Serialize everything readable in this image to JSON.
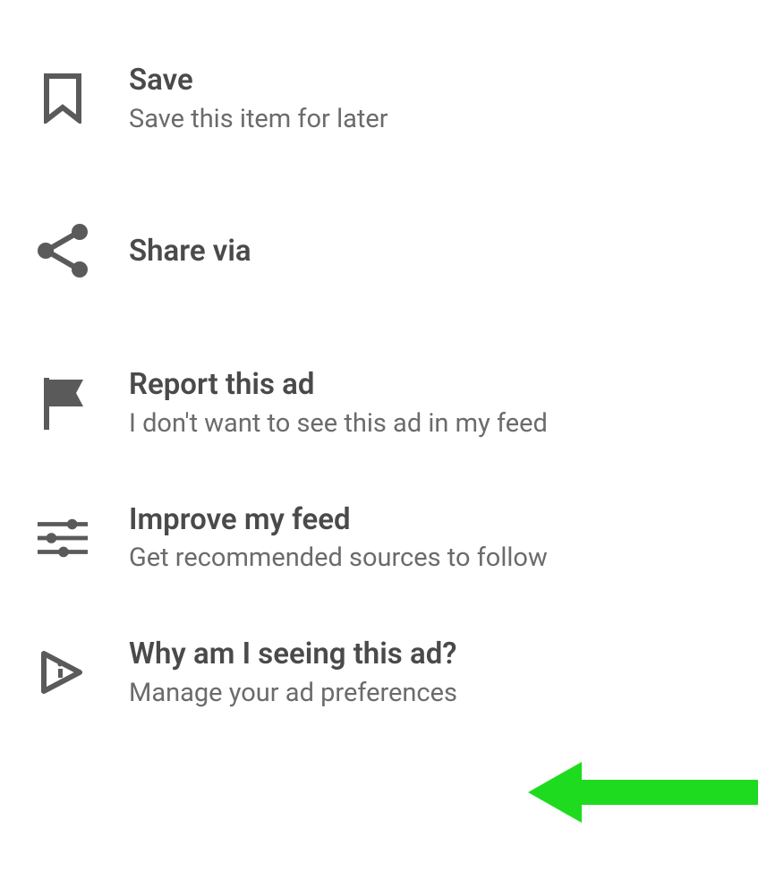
{
  "menu": {
    "items": [
      {
        "title": "Save",
        "subtitle": "Save this item for later"
      },
      {
        "title": "Share via",
        "subtitle": ""
      },
      {
        "title": "Report this ad",
        "subtitle": "I don't want to see this ad in my feed"
      },
      {
        "title": "Improve my feed",
        "subtitle": "Get recommended sources to follow"
      },
      {
        "title": "Why am I seeing this ad?",
        "subtitle": "Manage your ad preferences"
      }
    ]
  },
  "annotation": {
    "arrow_color": "#1FDB1F"
  }
}
